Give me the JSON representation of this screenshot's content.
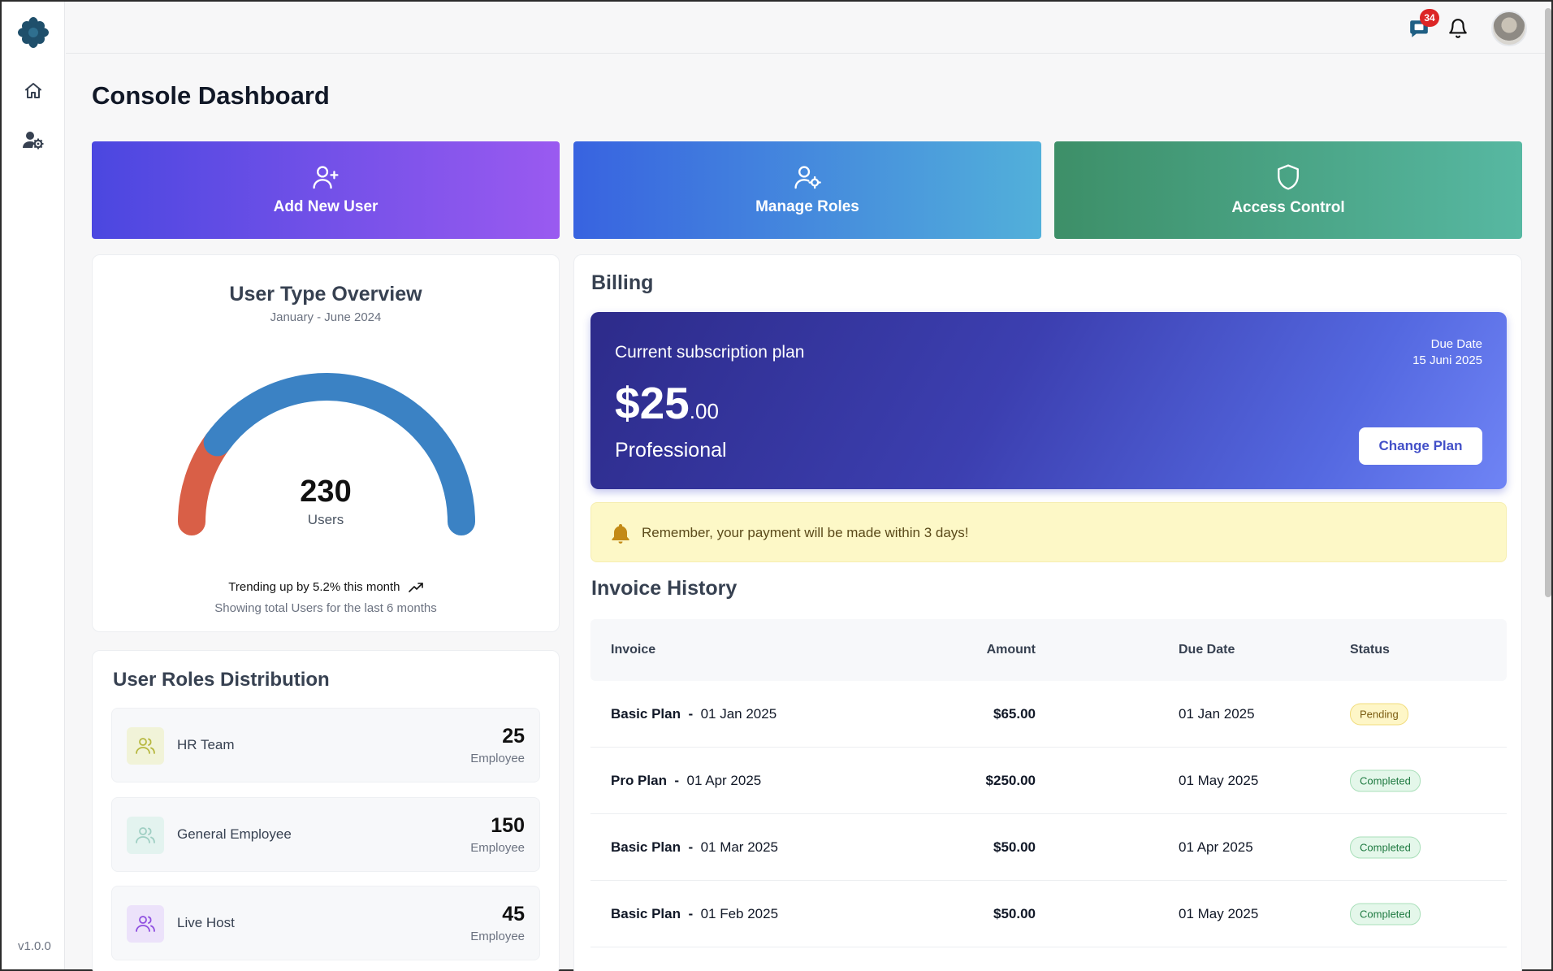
{
  "app": {
    "version": "v1.0.0",
    "page_title": "Console Dashboard",
    "notification_count": "34"
  },
  "sidebar": {
    "items": [
      {
        "icon": "home-icon"
      },
      {
        "icon": "user-settings-icon"
      }
    ]
  },
  "actions": [
    {
      "label": "Add New User",
      "icon": "add-user-icon",
      "colors": [
        "#4b47e0",
        "#9a5af0"
      ]
    },
    {
      "label": "Manage Roles",
      "icon": "user-gear-icon",
      "colors": [
        "#3863e0",
        "#52b0da"
      ]
    },
    {
      "label": "Access Control",
      "icon": "shield-icon",
      "colors": [
        "#3d8f68",
        "#57b8a2"
      ]
    }
  ],
  "overview": {
    "title": "User Type Overview",
    "subtitle": "January - June 2024",
    "total": "230",
    "total_label": "Users",
    "trend_text": "Trending up by 5.2% this month",
    "trend_sub": "Showing total Users for the last 6 months",
    "segments": [
      {
        "color": "#d95f47",
        "fraction": 0.2
      },
      {
        "color": "#3b82c4",
        "fraction": 0.8
      }
    ]
  },
  "roles": {
    "title": "User Roles Distribution",
    "items": [
      {
        "name": "HR Team",
        "count": "25",
        "unit": "Employee",
        "icon_bg": "#f1f3d8",
        "icon_color": "#b7b840"
      },
      {
        "name": "General Employee",
        "count": "150",
        "unit": "Employee",
        "icon_bg": "#e3f3ef",
        "icon_color": "#9fcfc3"
      },
      {
        "name": "Live Host",
        "count": "45",
        "unit": "Employee",
        "icon_bg": "#ece2fa",
        "icon_color": "#8f4fe0"
      }
    ]
  },
  "billing": {
    "title": "Billing",
    "plan_label": "Current subscription plan",
    "price_main": "$25",
    "price_cents": ".00",
    "plan_name": "Professional",
    "due_label": "Due Date",
    "due_value": "15 Juni 2025",
    "change_plan_label": "Change Plan",
    "reminder": "Remember, your payment will be made within 3 days!"
  },
  "invoices": {
    "title": "Invoice History",
    "columns": [
      "Invoice",
      "Amount",
      "Due Date",
      "Status"
    ],
    "rows": [
      {
        "plan": "Basic Plan",
        "date": "01 Jan 2025",
        "amount": "$65.00",
        "due": "01 Jan 2025",
        "status": "Pending"
      },
      {
        "plan": "Pro Plan",
        "date": "01 Apr 2025",
        "amount": "$250.00",
        "due": "01 May 2025",
        "status": "Completed"
      },
      {
        "plan": "Basic Plan",
        "date": "01 Mar 2025",
        "amount": "$50.00",
        "due": "01 Apr 2025",
        "status": "Completed"
      },
      {
        "plan": "Basic Plan",
        "date": "01 Feb 2025",
        "amount": "$50.00",
        "due": "01 May 2025",
        "status": "Completed"
      }
    ]
  }
}
